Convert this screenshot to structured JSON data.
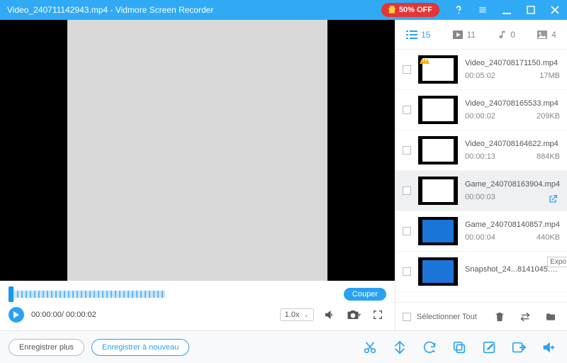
{
  "colors": {
    "accent": "#31aaf5",
    "promo": "#e33637"
  },
  "title": {
    "filename": "Video_240711142943.mp4",
    "separator": "  -  ",
    "app": "Vidmore Screen Recorder",
    "promo": "50% OFF"
  },
  "player": {
    "cut_label": "Couper",
    "time_current": "00:00:00",
    "time_total": "00:00:02",
    "speed": "1.0x"
  },
  "bottom": {
    "save_more": "Enregistrer plus",
    "save_again": "Enregistrer à nouveau"
  },
  "filters": {
    "list_count": "15",
    "video_count": "11",
    "audio_count": "0",
    "image_count": "4"
  },
  "items": [
    {
      "name": "Video_240708171150.mp4",
      "duration": "00:05:02",
      "size": "17MB",
      "thumb": "doc",
      "crown": true,
      "selected": false
    },
    {
      "name": "Video_240708165533.mp4",
      "duration": "00:00:02",
      "size": "209KB",
      "thumb": "doc",
      "crown": false,
      "selected": false
    },
    {
      "name": "Video_240708164622.mp4",
      "duration": "00:00:13",
      "size": "884KB",
      "thumb": "doc",
      "crown": false,
      "selected": false
    },
    {
      "name": "Game_240708163904.mp4",
      "duration": "00:00:03",
      "size": "",
      "thumb": "doc",
      "crown": false,
      "selected": true,
      "share": true
    },
    {
      "name": "Game_240708140857.mp4",
      "duration": "00:00:04",
      "size": "440KB",
      "thumb": "desk",
      "crown": false,
      "selected": false
    },
    {
      "name": "Snapshot_24...8141045.png",
      "duration": "",
      "size": "",
      "thumb": "desk",
      "crown": false,
      "selected": false
    }
  ],
  "right_footer": {
    "select_all": "Sélectionner Tout",
    "export_tooltip": "Expo"
  },
  "tool_names": [
    "cut",
    "split",
    "refresh",
    "copy",
    "edit",
    "export-right",
    "volume-add"
  ]
}
